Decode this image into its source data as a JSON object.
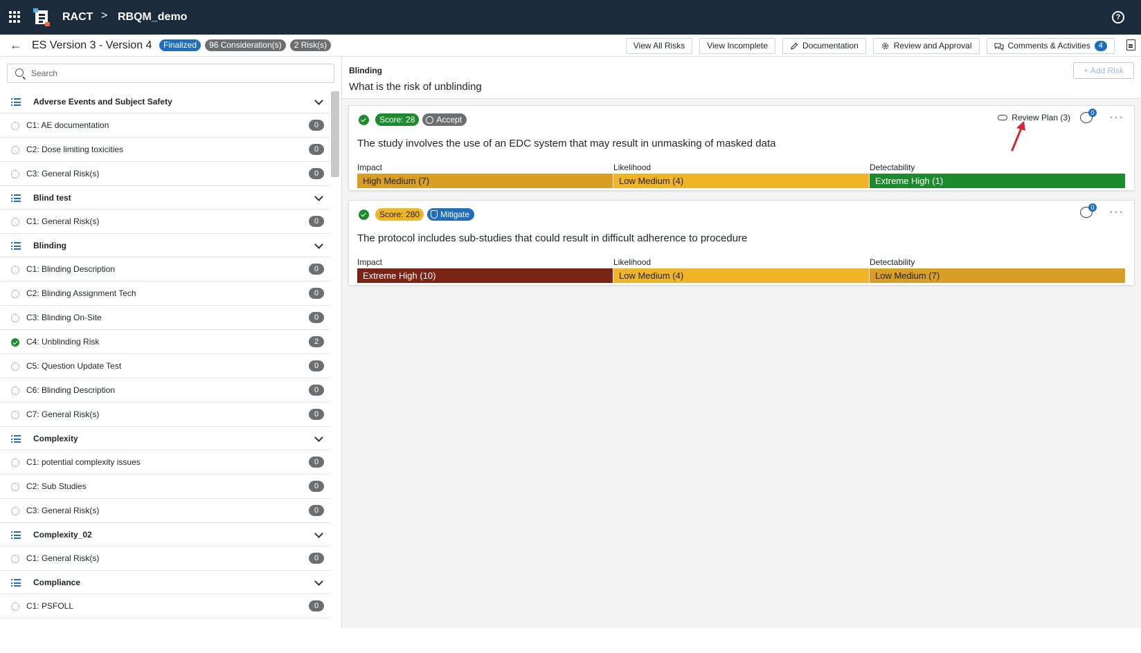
{
  "header": {
    "app_name": "RACT",
    "separator": ">",
    "project": "RBQM_demo",
    "help_glyph": "?"
  },
  "subheader": {
    "back_glyph": "←",
    "title": "ES Version 3 - Version 4",
    "badges": [
      "Finalized",
      "96 Consideration(s)",
      "2 Risk(s)"
    ],
    "actions": {
      "view_all_risks": "View All Risks",
      "view_incomplete": "View Incomplete",
      "documentation": "Documentation",
      "review_approval": "Review and Approval",
      "comments_activities": "Comments & Activities",
      "comments_count": "4"
    }
  },
  "sidebar": {
    "search_placeholder": "Search",
    "groups": [
      {
        "label": "Adverse Events and Subject Safety",
        "items": [
          {
            "label": "C1: AE documentation",
            "count": "0",
            "done": false
          },
          {
            "label": "C2: Dose limiting toxicities",
            "count": "0",
            "done": false
          },
          {
            "label": "C3: General Risk(s)",
            "count": "0",
            "done": false
          }
        ]
      },
      {
        "label": "Blind test",
        "items": [
          {
            "label": "C1: General Risk(s)",
            "count": "0",
            "done": false
          }
        ]
      },
      {
        "label": "Blinding",
        "items": [
          {
            "label": "C1: Blinding Description",
            "count": "0",
            "done": false
          },
          {
            "label": "C2: Blinding Assignment Tech",
            "count": "0",
            "done": false
          },
          {
            "label": "C3: Blinding On-Site",
            "count": "0",
            "done": false
          },
          {
            "label": "C4: Unblinding Risk",
            "count": "2",
            "done": true
          },
          {
            "label": "C5: Question Update Test",
            "count": "0",
            "done": false
          },
          {
            "label": "C6: Blinding Description",
            "count": "0",
            "done": false
          },
          {
            "label": "C7: General Risk(s)",
            "count": "0",
            "done": false
          }
        ]
      },
      {
        "label": "Complexity",
        "items": [
          {
            "label": "C1: potential complexity issues",
            "count": "0",
            "done": false
          },
          {
            "label": "C2: Sub Studies",
            "count": "0",
            "done": false
          },
          {
            "label": "C3: General Risk(s)",
            "count": "0",
            "done": false
          }
        ]
      },
      {
        "label": "Complexity_02",
        "items": [
          {
            "label": "C1: General Risk(s)",
            "count": "0",
            "done": false
          }
        ]
      },
      {
        "label": "Compliance",
        "items": [
          {
            "label": "C1: PSFOLL",
            "count": "0",
            "done": false
          }
        ]
      }
    ]
  },
  "main": {
    "section": "Blinding",
    "question": "What is the risk of unblinding",
    "add_risk": "+ Add Risk",
    "risks": [
      {
        "score": "Score: 28",
        "response": "Accept",
        "review_plan": "Review Plan (3)",
        "comments": "0",
        "more": "···",
        "text": "The study involves the use of an EDC system that may result in unmasking of masked data",
        "labels": {
          "impact": "Impact",
          "likelihood": "Likelihood",
          "detectability": "Detectability"
        },
        "impact": {
          "value": "High Medium (7)",
          "color": "#d99e24",
          "text_color": "#212529"
        },
        "likelihood": {
          "value": "Low Medium (4)",
          "color": "#f0b429",
          "text_color": "#212529"
        },
        "detectability": {
          "value": "Extreme High (1)",
          "color": "#1e8a2e",
          "text_color": "#ffffff"
        }
      },
      {
        "score": "Score: 280",
        "response": "Mitigate",
        "comments": "0",
        "more": "···",
        "text": "The protocol includes sub-studies that could result in difficult adherence to procedure",
        "labels": {
          "impact": "Impact",
          "likelihood": "Likelihood",
          "detectability": "Detectability"
        },
        "impact": {
          "value": "Extreme High (10)",
          "color": "#7b2415",
          "text_color": "#ffffff"
        },
        "likelihood": {
          "value": "Low Medium (4)",
          "color": "#f0b429",
          "text_color": "#212529"
        },
        "detectability": {
          "value": "Low Medium (7)",
          "color": "#d99e24",
          "text_color": "#212529"
        }
      }
    ]
  },
  "colors": {
    "topbar": "#1b2b3c",
    "accent_blue": "#1e6ebd",
    "success_green": "#1e8a2e",
    "annotation_red": "#d0282e"
  }
}
